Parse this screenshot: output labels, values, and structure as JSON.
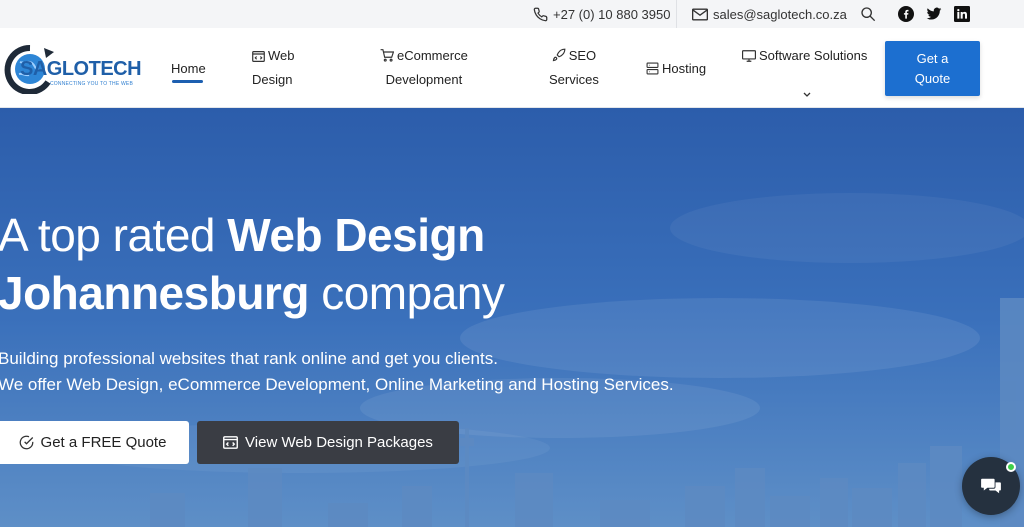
{
  "topbar": {
    "phone": "+27 (0) 10 880 3950",
    "email": "sales@saglotech.co.za"
  },
  "logo": {
    "name": "SAGLOTECH",
    "tagline": "CONNECTING YOU TO THE WEB"
  },
  "nav": {
    "home": "Home",
    "web_design_1": "Web",
    "web_design_2": "Design",
    "ecommerce_1": "eCommerce",
    "ecommerce_2": "Development",
    "seo_1": "SEO",
    "seo_2": "Services",
    "hosting": "Hosting",
    "software": "Software Solutions",
    "quote_1": "Get a",
    "quote_2": "Quote"
  },
  "hero": {
    "line1_normal": "A top rated ",
    "line1_bold": "Web Design",
    "line2_bold": "Johannesburg",
    "line2_normal": " company",
    "sub1": "Building professional websites that rank online and get you clients.",
    "sub2": "We offer Web Design, eCommerce Development, Online Marketing and Hosting Services.",
    "btn_quote": "Get a FREE Quote",
    "btn_packages": "View Web Design Packages"
  },
  "colors": {
    "accent": "#1c6fd0",
    "hero_bg": "#3569b6",
    "dark_button": "#3a3d44",
    "online": "#3fcf4a"
  }
}
